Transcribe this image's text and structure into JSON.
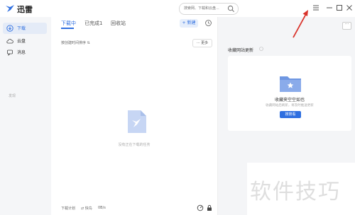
{
  "app": {
    "title": "迅雷"
  },
  "search": {
    "placeholder": "搜索网、下载和云盘..."
  },
  "sidebar": {
    "items": [
      {
        "label": "下载",
        "icon": "download-icon",
        "active": true
      },
      {
        "label": "云盘",
        "icon": "cloud-icon",
        "active": false
      },
      {
        "label": "消息",
        "icon": "message-icon",
        "active": false
      }
    ],
    "dim_label": "发现"
  },
  "tabs": [
    {
      "label": "下载中",
      "active": true
    },
    {
      "label": "已完成1",
      "active": false
    },
    {
      "label": "回收站",
      "active": false
    }
  ],
  "toolbar": {
    "new_label": "+ 新建",
    "more_label": "··· 更多"
  },
  "list": {
    "sort_label": "按创建时间排序 ⇅",
    "empty_text": "没有正在下载的任务"
  },
  "footer": {
    "plan_label": "下载计划",
    "speed_label": "⇄ 快鸟",
    "speed_value": "0B/s"
  },
  "right_panel": {
    "section_title": "收藏网站更新",
    "card": {
      "title": "收藏夹空空如也",
      "subtitle": "收藏网站后刷新，将及时推送更新",
      "button_label": "搜搜看"
    }
  },
  "watermark": {
    "text": "软件技巧"
  },
  "colors": {
    "accent": "#2f6fe0",
    "annotation_arrow": "#d9322a"
  }
}
